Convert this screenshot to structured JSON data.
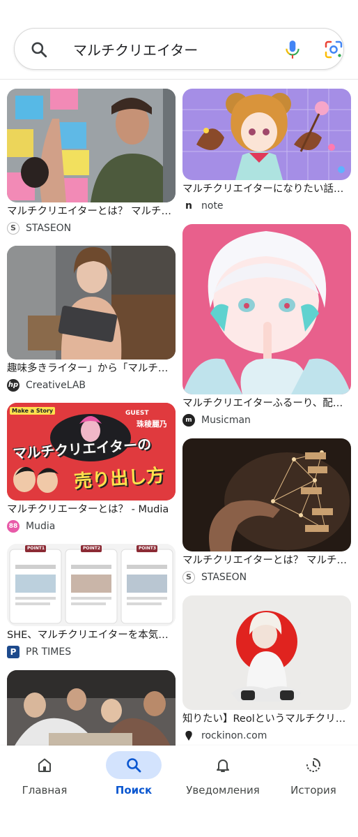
{
  "search": {
    "query": "マルチクリエイター",
    "icons": [
      "search-icon",
      "mic-icon",
      "lens-icon"
    ]
  },
  "results": {
    "left": [
      {
        "caption": "マルチクリエイターとは？ マルチ…",
        "source": "STASEON",
        "favicon": "staseon-icon"
      },
      {
        "caption": "趣味多きライター」から「マルチ…",
        "source": "CreativeLAB",
        "favicon": "hp-icon"
      },
      {
        "caption": "マルチクリエーターとは？ - Mudia",
        "source": "Mudia",
        "favicon": "mudia-icon",
        "thumb_text": {
          "badge": "Make a Story",
          "guest": "GUEST",
          "name": "珠稜麗乃",
          "headline1": "マルチクリエイターの",
          "headline2": "売り出し方"
        }
      },
      {
        "caption": "SHE、マルチクリエイターを本気…",
        "source": "PR TIMES",
        "favicon": "prtimes-icon",
        "thumb_text": {
          "points": [
            "POINT1",
            "POINT2",
            "POINT3"
          ]
        }
      },
      {
        "caption": "",
        "source": "",
        "favicon": ""
      }
    ],
    "right": [
      {
        "caption": "マルチクリエイターになりたい話…",
        "source": "note",
        "favicon": "note-icon"
      },
      {
        "caption": "マルチクリエイターふるーり、配…",
        "source": "Musicman",
        "favicon": "musicman-icon"
      },
      {
        "caption": "マルチクリエイターとは？ マルチ…",
        "source": "STASEON",
        "favicon": "staseon-icon"
      },
      {
        "caption": "知りたい】Reolというマルチクリ…",
        "source": "rockinon.com",
        "favicon": "rockinon-icon"
      }
    ]
  },
  "nav": {
    "items": [
      {
        "label": "Главная",
        "icon": "home-icon",
        "active": false
      },
      {
        "label": "Поиск",
        "icon": "search-icon",
        "active": true
      },
      {
        "label": "Уведомления",
        "icon": "bell-icon",
        "active": false
      },
      {
        "label": "История",
        "icon": "history-icon",
        "active": false
      }
    ]
  },
  "colors": {
    "accent": "#0b57d0",
    "active_pill": "#d3e3fd"
  }
}
